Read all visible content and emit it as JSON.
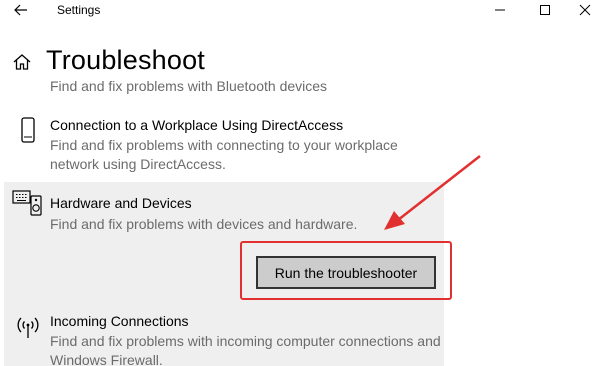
{
  "window": {
    "title": "Settings"
  },
  "header": {
    "title": "Troubleshoot"
  },
  "items": {
    "partial": {
      "desc": "Find and fix problems with Bluetooth devices"
    },
    "workplace": {
      "name": "Connection to a Workplace Using DirectAccess",
      "desc": "Find and fix problems with connecting to your workplace network using DirectAccess."
    },
    "hardware": {
      "name": "Hardware and Devices",
      "desc": "Find and fix problems with devices and hardware.",
      "button_label": "Run the troubleshooter"
    },
    "incoming": {
      "name": "Incoming Connections",
      "desc": "Find and fix problems with incoming computer connections and Windows Firewall."
    }
  },
  "icons": {
    "back": "back-arrow-icon",
    "home": "home-icon",
    "workplace": "phone-device-icon",
    "hardware": "keyboard-speaker-icon",
    "incoming": "wireless-signal-icon"
  },
  "colors": {
    "annotation": "#e23030",
    "selected_bg": "#efefef",
    "button_bg": "#cccccc"
  }
}
